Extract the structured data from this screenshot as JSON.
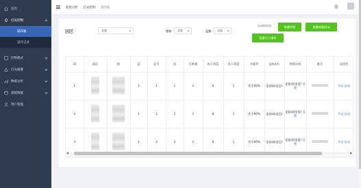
{
  "sidebar": {
    "items": [
      {
        "label": "首页",
        "icon": "home-icon"
      },
      {
        "label": "灯光控制",
        "icon": "bulb-icon",
        "open": true
      },
      {
        "label": "控制模式",
        "icon": "mode-icon"
      },
      {
        "label": "灯光报警",
        "icon": "alarm-icon"
      },
      {
        "label": "数据分析",
        "icon": "chart-icon"
      },
      {
        "label": "基础数据",
        "icon": "database-icon"
      },
      {
        "label": "用户管理",
        "icon": "user-icon"
      }
    ],
    "subitems": [
      {
        "label": "操作板",
        "active": true
      },
      {
        "label": "操作记录",
        "active": false
      }
    ]
  },
  "header": {
    "breadcrumb": [
      "能耗分析",
      "灯光控制",
      "操作板"
    ]
  },
  "filters": {
    "area_title": "园区",
    "area_select": "全部",
    "building_label": "楼栋",
    "building_select": "全部",
    "floor_label": "层数",
    "floor_select": "全部",
    "hint": "批量照明控制",
    "buttons": [
      "批量控制",
      "批量恢复启动",
      "批量引入操作"
    ]
  },
  "table": {
    "columns": [
      "ID",
      "园区",
      "楼",
      "层",
      "区号",
      "组",
      "灯数量",
      "有人亮度",
      "无人亮度",
      "节能率",
      "当前执行",
      "常规计划",
      "备注",
      "远程控"
    ],
    "rows": [
      {
        "id": "1",
        "floor": "1",
        "zone": "1",
        "group": "1",
        "lamps": "1",
        "on_bright": "8",
        "off_bright": "1",
        "saving": "大于60%",
        "current": "全自动(全日)",
        "plan": "全自动(全日)",
        "plan_link": "设置",
        "remote": [
          "手动",
          "自动"
        ]
      },
      {
        "id": "2",
        "floor": "1",
        "zone": "2",
        "group": "2",
        "lamps": "1",
        "on_bright": "8",
        "off_bright": "1",
        "saving": "大于60%",
        "current": "全自动(全日)",
        "plan": "全自动(全日)",
        "plan_link": "设置",
        "remote": [
          "手动",
          "自动"
        ]
      },
      {
        "id": "3",
        "floor": "1",
        "zone": "3",
        "group": "3",
        "lamps": "1",
        "on_bright": "8",
        "off_bright": "1",
        "saving": "大于60%",
        "current": "全自动(全日)",
        "plan": "全自动(全日)",
        "plan_link": "设置",
        "remote": [
          "手动",
          "自动"
        ]
      }
    ]
  },
  "colors": {
    "sidebar_bg": "#2e3a4e",
    "active_menu": "#3a66b7",
    "green_button": "#52c41a",
    "link": "#3a8ee6"
  }
}
